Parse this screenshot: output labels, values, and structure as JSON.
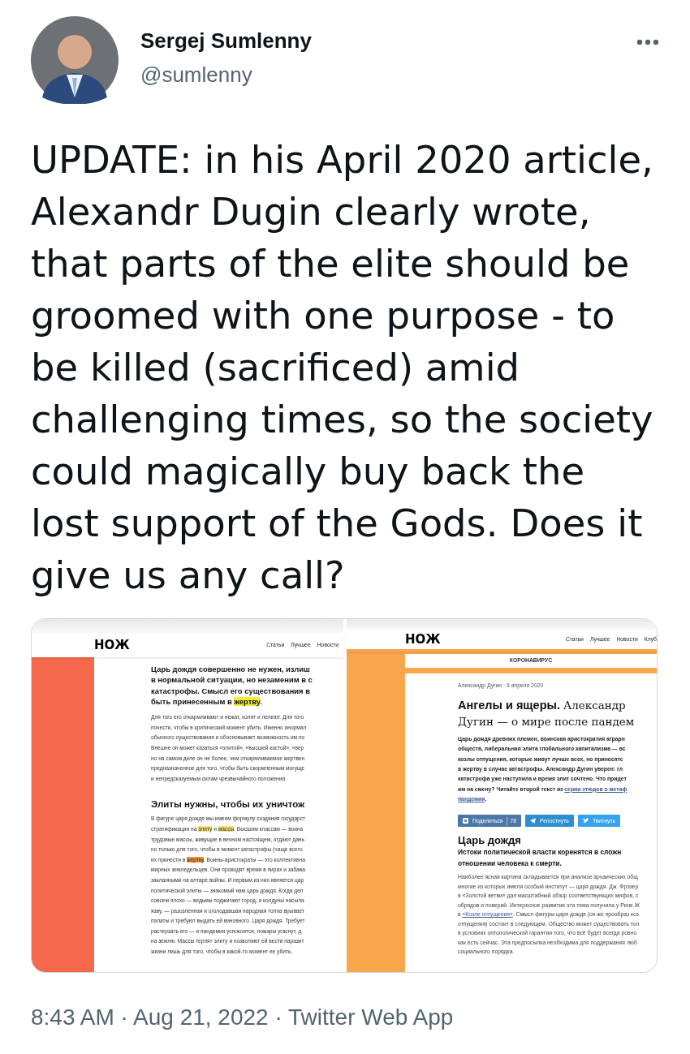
{
  "author": {
    "name": "Sergej Sumlenny",
    "handle": "@sumlenny"
  },
  "tweet_text": "UPDATE: in his April 2020 article, Alexandr Dugin clearly wrote, that parts of the elite should be groomed with one purpose - to be killed (sacrificed) amid challenging times, so the society could magically buy back the lost support of the Gods. Does it give us any call?",
  "attached_image": {
    "panels": [
      {
        "logo": "НОЖ",
        "nav": [
          "Статьи",
          "Лучшее",
          "Новости"
        ],
        "color": "#f4694b",
        "blocks": [
          {
            "kind": "headline",
            "lines": [
              "Царь дождя совершенно не нужен, излиш",
              "в нормальной ситуации, но незаменим в с",
              "катастрофы. Смысл его существования в",
              [
                {
                  "text": "быть принесенным в ",
                  "kind": "plain"
                },
                {
                  "text": "жертву",
                  "kind": "mark",
                  "color": "#f5ee2e"
                },
                {
                  "text": ".",
                  "kind": "plain"
                }
              ]
            ]
          },
          {
            "kind": "body",
            "lines": [
              "Для того его откармливают и нежат, холят и лелеют. Для того",
              "почести, чтобы в критический момент убить. Именно анормал",
              "обычного существования и обосновывает возможность им по",
              "Внешне он может казаться «элитой», «высшей кастой», «вер",
              "но на самом деле он не более, чем откармливаемое жертвен",
              "предназначенное для того, чтобы быть скормленным могуще",
              "и непредсказуемым силам чрезвычайного положения."
            ]
          },
          {
            "kind": "heading",
            "lines": [
              "Элиты нужны, чтобы их уничтож"
            ]
          },
          {
            "kind": "body",
            "lines": [
              "В фигуре царя дождя мы имеем формулу создания государст",
              [
                {
                  "text": "стратификации на ",
                  "kind": "plain"
                },
                {
                  "text": "элиту",
                  "kind": "mark",
                  "color": "#f6e27a"
                },
                {
                  "text": " и ",
                  "kind": "plain"
                },
                {
                  "text": "массы",
                  "kind": "mark",
                  "color": "#f6e27a"
                },
                {
                  "text": ". Высшим классам — воина",
                  "kind": "plain"
                }
              ],
              "трудовые массы, живущие в вечном настоящем, отдают дань",
              "но только для того, чтобы в момент катастрофы (чаще всего",
              [
                {
                  "text": "их принести в ",
                  "kind": "plain"
                },
                {
                  "text": "жертву",
                  "kind": "mark",
                  "color": "#f0963a"
                },
                {
                  "text": ". Воины-аристократы — это коллективна",
                  "kind": "plain"
                }
              ],
              "мирных земледельцев. Они проводят время в пирах и забава",
              "закланными на алтаре войны. И первым из них является цар",
              "политической элиты — знакомый нам царь дождя. Когда дел",
              "совсем плохо — ведьмы поджигают город, а колдуны насыла",
              "язву, — разозленная и оголодавшая народная толпа врывает",
              "палаты и требуют выдать ей виновного. Царя дождя. Требует",
              "растерзать его — и пандемия успокоится, пожары угаснут, д",
              "на землю. Массы терпят элиту и позволяют ей вести паразит",
              "жизни лишь для того, чтобы в какой-то момент ее убить."
            ]
          }
        ]
      },
      {
        "logo": "НОЖ",
        "nav": [
          "Статьи",
          "Лучшее",
          "Новости",
          "Клуб"
        ],
        "color": "#f9a64c",
        "banner": "КОРОНАВИРУС",
        "blocks": [
          {
            "kind": "byline",
            "lines": [
              "Александр Дугин · 9 апреля 2020"
            ]
          },
          {
            "kind": "title",
            "lines": [
              [
                {
                  "text": "Ангелы и ящеры. ",
                  "kind": "sans"
                },
                {
                  "text": "Александр",
                  "kind": "serif"
                }
              ],
              [
                {
                  "text": "Дугин — о мире после пандем",
                  "kind": "serif"
                }
              ]
            ]
          },
          {
            "kind": "lead",
            "lines": [
              "Царь дождя древних племен, воинская аристократия аграрн",
              "обществ, либеральная элита глобального капитализма — вс",
              "козлы отпущения, которые живут лучше всех, но приносятс",
              "в жертву в случае катастрофы. Александр Дугин уверен: гл",
              "катастрофа уже наступила и время элит сочтено. Что придет",
              [
                {
                  "text": "им на смену? Читайте второй текст из ",
                  "kind": "plain"
                },
                {
                  "text": "серии этюдов о метаф",
                  "kind": "link"
                }
              ],
              [
                {
                  "text": "пандемии",
                  "kind": "link"
                },
                {
                  "text": ".",
                  "kind": "plain"
                }
              ]
            ]
          },
          {
            "kind": "share",
            "buttons": [
              {
                "kind": "vk",
                "label": "Поделиться",
                "count": "78",
                "color": "#4b77a9"
              },
              {
                "kind": "telegram",
                "label": "Репостнуть",
                "color": "#2d8fcf"
              },
              {
                "kind": "twitter",
                "label": "Твитнуть",
                "color": "#35a3ee"
              }
            ]
          },
          {
            "kind": "heading",
            "lines": [
              "Царь дождя"
            ]
          },
          {
            "kind": "subheading",
            "lines": [
              "Истоки политической власти коренятся в сложн",
              "отношении человека к смерти."
            ]
          },
          {
            "kind": "small",
            "lines": [
              "Наиболее ясная картина складывается при анализе архаических общ",
              "многие из которых имели особый институт — царя дождя. Дж. Фрэзер",
              "в «Золотой ветви» дал масштабный обзор соответствующих мифов, с",
              "обрядов и поверий. Интересное развитие эта тема получила у Рене Ж",
              [
                {
                  "text": "в ",
                  "kind": "plain"
                },
                {
                  "text": "«Козле отпущения»",
                  "kind": "link"
                },
                {
                  "text": ". Смысл фигуры царя дождя (он же прообраз коз",
                  "kind": "plain"
                }
              ],
              "отпущения) состоит в следующем. Общество может существовать тол",
              "в условиях онтологической гарантии того, что всё будет всегда ровно",
              "как есть сейчас. Эта предпосылка необходима для поддержания люб",
              "социального порядка."
            ]
          }
        ]
      }
    ]
  },
  "meta": "8:43 AM · Aug 21, 2022 · Twitter Web App"
}
